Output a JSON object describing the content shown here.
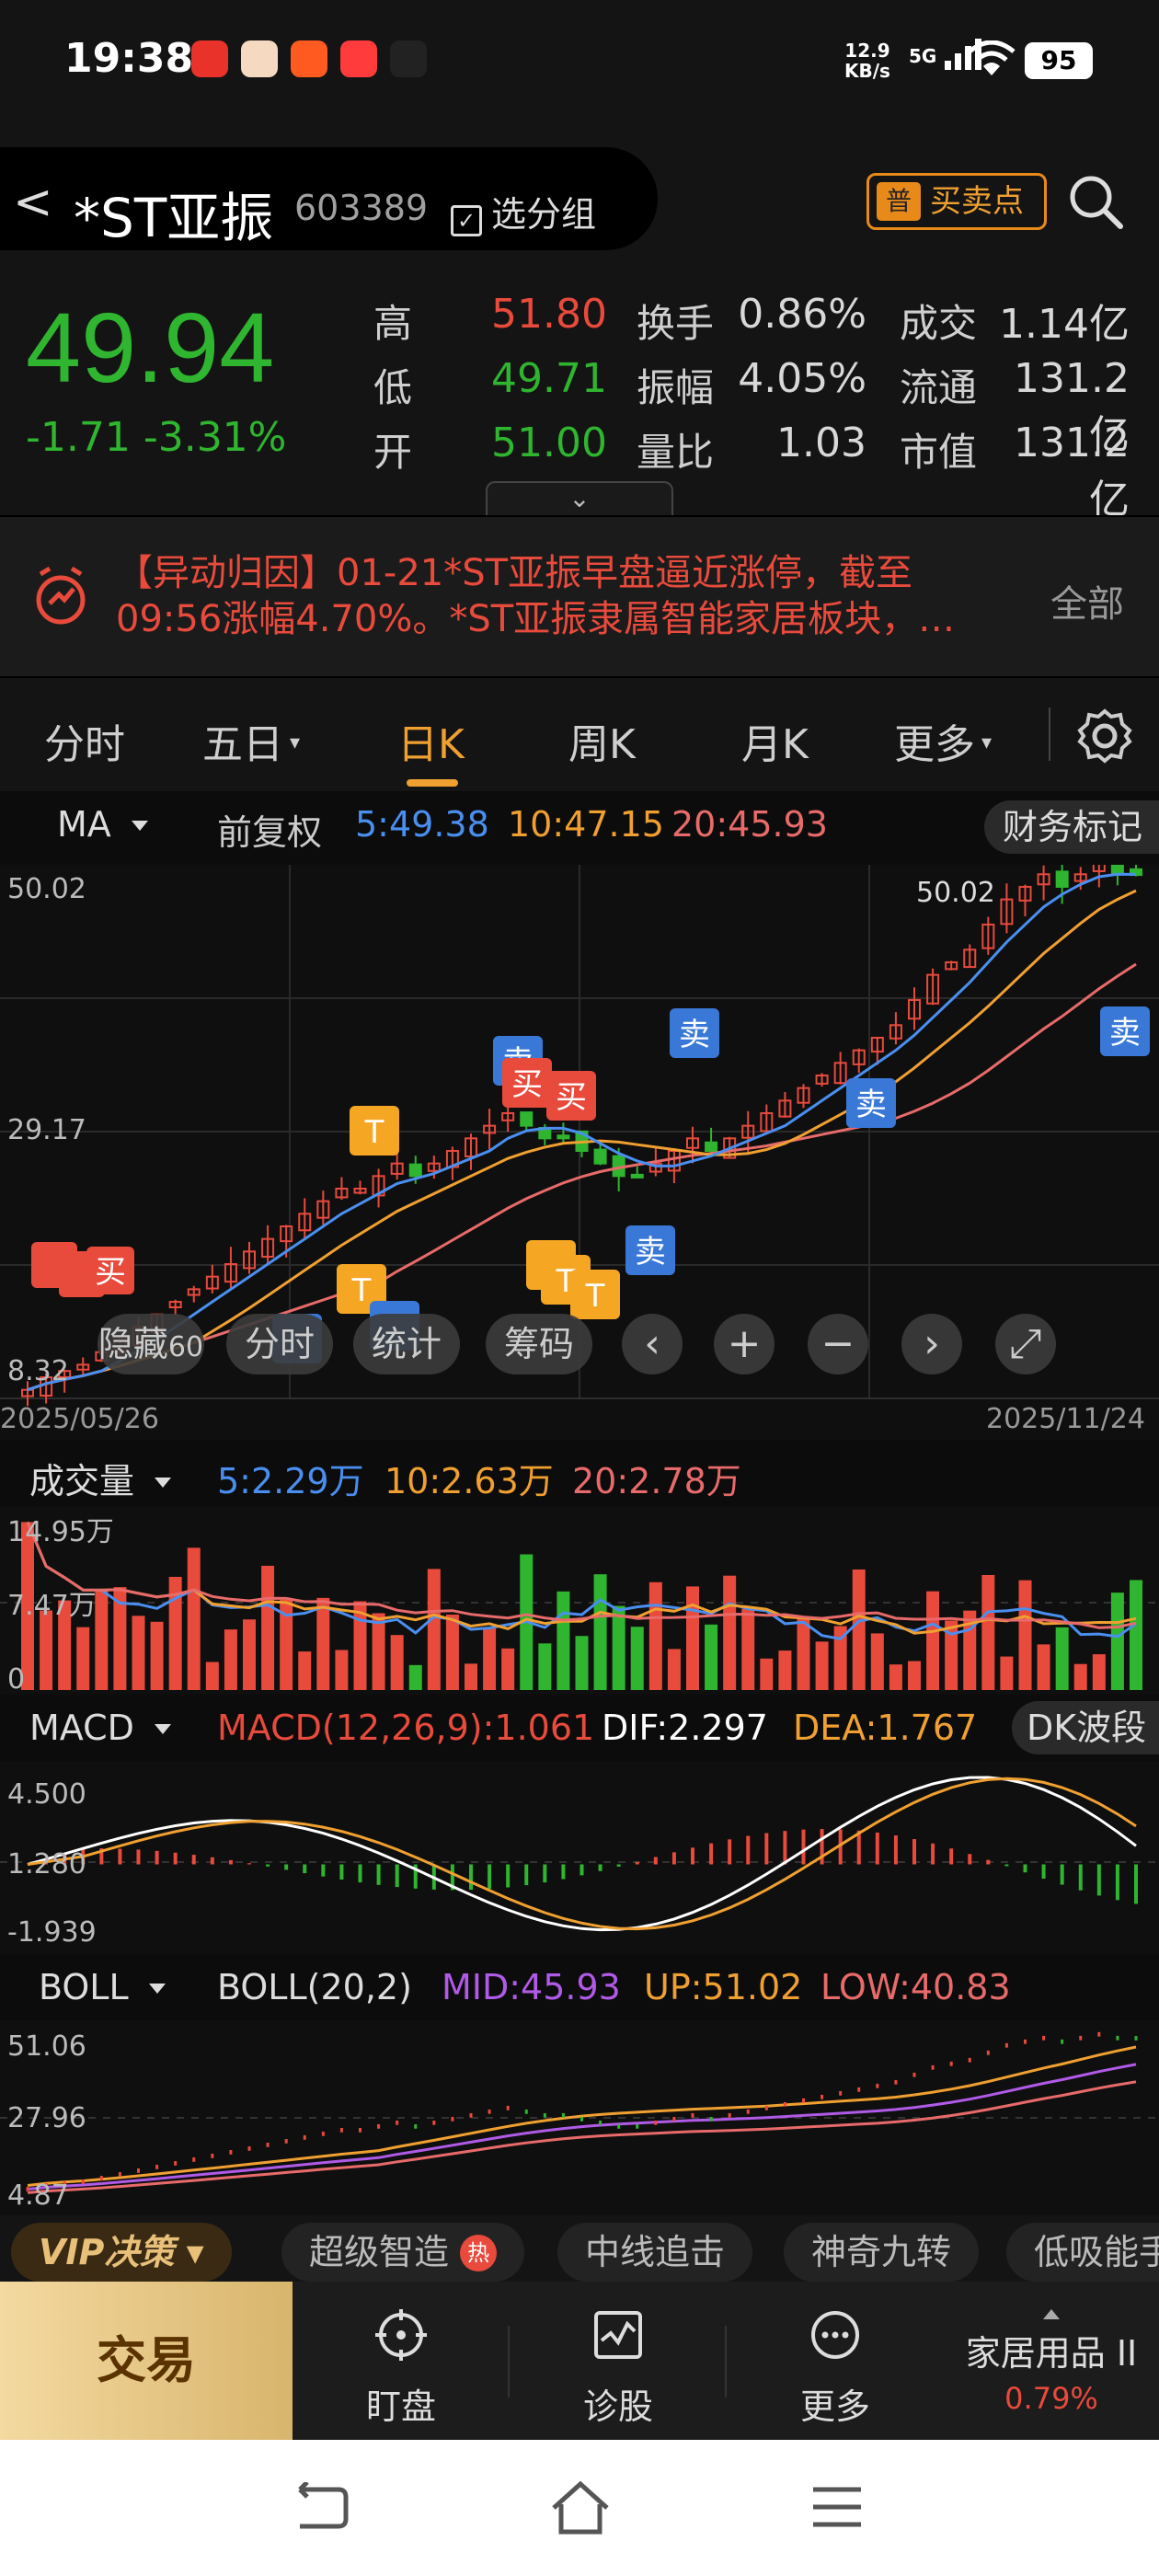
{
  "status": {
    "time": "19:38",
    "speed_value": "12.9",
    "speed_unit": "KB/s",
    "network": "5G",
    "battery": "95"
  },
  "header": {
    "back": "<",
    "name": "*ST亚振",
    "code": "603389",
    "group": "选分组",
    "bs_icon": "普",
    "bs_label": "买卖点"
  },
  "quote": {
    "price": "49.94",
    "change": "-1.71  -3.31%",
    "items": [
      {
        "label": "高",
        "value": "51.80"
      },
      {
        "label": "低",
        "value": "49.71"
      },
      {
        "label": "开",
        "value": "51.00"
      },
      {
        "label": "换手",
        "value": "0.86%"
      },
      {
        "label": "振幅",
        "value": "4.05%"
      },
      {
        "label": "量比",
        "value": "1.03"
      },
      {
        "label": "成交",
        "value": "1.14亿"
      },
      {
        "label": "流通",
        "value": "131.2亿"
      },
      {
        "label": "市值",
        "value": "131.2亿"
      }
    ],
    "expand": "⌄"
  },
  "news": {
    "text": "【异动归因】01-21*ST亚振早盘逼近涨停，截至09:56涨幅4.70%。*ST亚振隶属智能家居板块，…",
    "all": "全部"
  },
  "tabs": [
    "分时",
    "五日",
    "日K",
    "周K",
    "月K",
    "更多"
  ],
  "ma_row": {
    "indicator": "MA",
    "adjust": "前复权",
    "ma5": "5:49.38",
    "ma10": "10:47.15",
    "ma20": "20:45.93",
    "fin": "财务标记"
  },
  "kline": {
    "top": "50.02",
    "mid": "29.17",
    "bottom": "8.32",
    "high_label": "50.02",
    "date_start": "2025/05/26",
    "date_end": "2025/11/24",
    "signals": {
      "buy": "买",
      "sell": "卖",
      "t": "T"
    },
    "controls": [
      "隐藏",
      "分时",
      "统计",
      "筹码"
    ],
    "controls_partial": "60"
  },
  "volume_row": {
    "name": "成交量",
    "v5": "5:2.29万",
    "v10": "10:2.63万",
    "v20": "20:2.78万",
    "top": "14.95万",
    "mid": "7.47万",
    "bottom": "0"
  },
  "macd_row": {
    "name": "MACD",
    "params": "MACD(12,26,9):1.061",
    "dif": "DIF:2.297",
    "dea": "DEA:1.767",
    "extra": "DK波段",
    "top": "4.500",
    "mid": "1.280",
    "bottom": "-1.939"
  },
  "boll_row": {
    "name": "BOLL",
    "params": "BOLL(20,2)",
    "mid": "MID:45.93",
    "up": "UP:51.02",
    "low": "LOW:40.83",
    "top": "51.06",
    "mid_axis": "27.96",
    "bottom": "4.87"
  },
  "quicktabs": {
    "vip": "VIP决策",
    "items": [
      "超级智造",
      "中线追击",
      "神奇九转",
      "低吸能手"
    ],
    "hot": "热"
  },
  "bottom": {
    "trade": "交易",
    "items": [
      "盯盘",
      "诊股",
      "更多"
    ],
    "sector": "家居用品 II",
    "sector_change": "0.79%"
  },
  "colors": {
    "up": "#e84a3c",
    "down": "#2fb52f",
    "ma5": "#4a8ff0",
    "ma10": "#f0a030",
    "ma20": "#e86a6a",
    "accent": "#f0a030"
  },
  "chart_data": {
    "type": "candlestick",
    "x_range": [
      "2025/05/26",
      "2025/11/24"
    ],
    "y_axis_ticks": [
      8.32,
      29.17,
      50.02
    ],
    "close_series": [
      9,
      10,
      10.5,
      11,
      12,
      13,
      14,
      15,
      16,
      17,
      18,
      19,
      20,
      21,
      22,
      23,
      24,
      25,
      25,
      26,
      27,
      26,
      27,
      28,
      29,
      30,
      31,
      30,
      29,
      29,
      28,
      27,
      26,
      26,
      27,
      28,
      29,
      28,
      29,
      30,
      31,
      32,
      33,
      34,
      35,
      36,
      37,
      38,
      40,
      42,
      43,
      44,
      46,
      48,
      49,
      50,
      49,
      50,
      51,
      50,
      49.94
    ],
    "volume_axis": [
      0,
      7.47,
      14.95
    ],
    "macd_axis": [
      -1.939,
      1.28,
      4.5
    ],
    "boll_axis": [
      4.87,
      27.96,
      51.06
    ]
  }
}
